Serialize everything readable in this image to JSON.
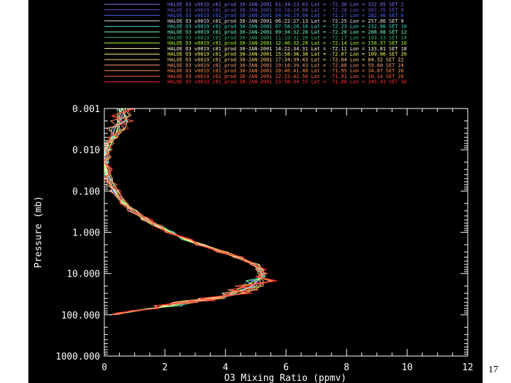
{
  "page_number": "17",
  "chart_data": {
    "type": "line",
    "xlabel": "O3 Mixing Ratio (ppmv)",
    "ylabel": "Pressure (mb)",
    "xlim": [
      0,
      12
    ],
    "ylim": [
      1000,
      0.001
    ],
    "yscale": "log",
    "x_ticks": [
      "0",
      "2",
      "4",
      "6",
      "8",
      "10",
      "12"
    ],
    "y_ticks": [
      "0.001",
      "0.010",
      "0.100",
      "1.000",
      "10.000",
      "100.000",
      "1000.000"
    ],
    "legend_placement": "top",
    "base_profile": {
      "pressure": [
        100,
        90,
        80,
        70,
        60,
        50,
        45,
        40,
        35,
        30,
        25,
        20,
        15,
        12,
        10,
        8,
        6,
        5,
        4,
        3,
        2,
        1.5,
        1,
        0.7,
        0.5,
        0.3,
        0.2,
        0.1,
        0.07,
        0.05,
        0.03,
        0.02,
        0.015,
        0.01,
        0.007,
        0.005,
        0.003,
        0.002,
        0.0015,
        0.001
      ],
      "o3": [
        0.3,
        0.55,
        1.0,
        1.6,
        2.2,
        2.6,
        3.1,
        3.6,
        4.0,
        4.3,
        4.6,
        4.9,
        5.1,
        5.2,
        5.2,
        5.15,
        5.0,
        4.7,
        4.4,
        3.9,
        3.2,
        2.7,
        2.2,
        1.75,
        1.4,
        0.95,
        0.65,
        0.35,
        0.22,
        0.15,
        0.08,
        0.05,
        0.05,
        0.08,
        0.15,
        0.3,
        0.45,
        0.55,
        0.6,
        0.7
      ]
    },
    "series": [
      {
        "label": "HALOE O3 v0019_c01_prod 30-JAN-2001 01:34:23.03 Lat = -72.30 Lon = 332.05 SET 2",
        "color": "#7a7aff",
        "dx": 0.0
      },
      {
        "label": "HALOE O3 v0019_c01_prod 30-JAN-2001 03:10:24.08 Lat = -72.28 Lon = 307.35 SET 4",
        "color": "#6a5acd",
        "dx": 0.1
      },
      {
        "label": "HALOE O3 v0019_c01_prod 30-JAN-2001 04:46:25.08 Lat = -72.27 Lon = 282.46 SET 6",
        "color": "#4169ff",
        "dx": -0.1
      },
      {
        "label": "HALOE O3 v0019_c01_prod 30-JAN-2001 06:22:27.13 Lat = -72.25 Lon = 257.86 SET 8",
        "color": "#e6e6e6",
        "dx": 0.05
      },
      {
        "label": "HALOE O3 v0019_c01_prod 30-JAN-2001 07:58:28.16 Lat = -72.23 Lon = 232.86 SET 10",
        "color": "#40e0d0",
        "dx": -0.05
      },
      {
        "label": "HALOE O3 v0019_c01_prod 30-JAN-2001 09:34:32.28 Lat = -72.20 Lon = 208.08 SET 12",
        "color": "#7fffd4",
        "dx": 0.15
      },
      {
        "label": "HALOE O3 v0019_c01_prod 30-JAN-2001 11:10:32.28 Lat = -72.17 Lon = 183.33 SET 14",
        "color": "#3cb371",
        "dx": -0.15
      },
      {
        "label": "HALOE O3 v0019_c01_prod 30-JAN-2001 12:46:32.28 Lat = -72.14 Lon = 158.57 SET 16",
        "color": "#adff2f",
        "dx": 0.08
      },
      {
        "label": "HALOE O3 v0019_c01_prod 30-JAN-2001 14:22:34.31 Lat = -72.11 Lon = 133.81 SET 18",
        "color": "#ffffe0",
        "dx": -0.08
      },
      {
        "label": "HALOE O3 v0019_c01_prod 30-JAN-2001 15:58:36.38 Lat = -72.07 Lon = 109.06 SET 20",
        "color": "#ffff66",
        "dx": 0.12
      },
      {
        "label": "HALOE O3 v0019_c01_prod 30-JAN-2001 17:34:39.43 Lat = -72.04 Lon = 84.32 SET 22",
        "color": "#ffd27f",
        "dx": -0.12
      },
      {
        "label": "HALOE O3 v0019_c01_prod 30-JAN-2001 19:10:39.43 Lat = -72.00 Lon = 59.60 SET 24",
        "color": "#ffa07a",
        "dx": 0.18
      },
      {
        "label": "HALOE O3 v0019_c01_prod 30-JAN-2001 20:46:41.48 Lat = -71.95 Lon = 34.87 SET 26",
        "color": "#ff8c42",
        "dx": -0.18
      },
      {
        "label": "HALOE O3 v0019_c01_prod 30-JAN-2001 22:22:42.50 Lat = -71.91 Lon = 10.14 SET 28",
        "color": "#ff6347",
        "dx": 0.2
      },
      {
        "label": "HALOE O3 v0019_c01_prod 30-JAN-2001 23:58:44.55 Lat = -71.86 Lon = 345.43 SET 30",
        "color": "#ff3030",
        "dx": -0.2
      }
    ]
  }
}
